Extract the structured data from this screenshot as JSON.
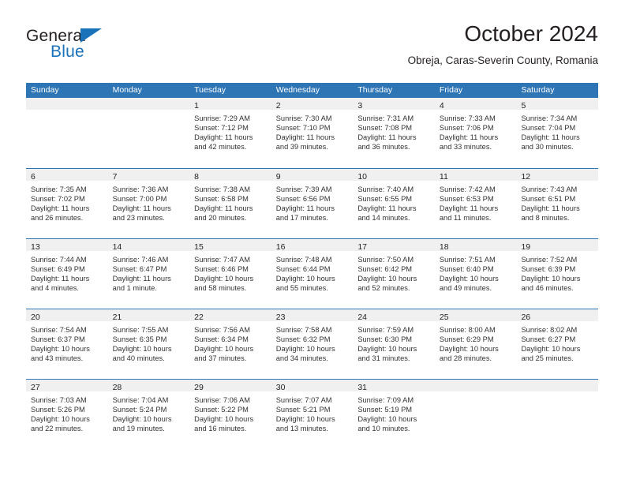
{
  "logo": {
    "word_top": "General",
    "word_bottom": "Blue",
    "accent_color": "#1a72ba"
  },
  "header": {
    "title": "October 2024",
    "subtitle": "Obreja, Caras-Severin County, Romania"
  },
  "theme": {
    "header_blue": "#2e75b6",
    "daynum_band": "#f0f0f0",
    "text": "#333333"
  },
  "calendar": {
    "weekdays": [
      "Sunday",
      "Monday",
      "Tuesday",
      "Wednesday",
      "Thursday",
      "Friday",
      "Saturday"
    ],
    "weeks": [
      [
        {
          "day": "",
          "empty": true
        },
        {
          "day": "",
          "empty": true
        },
        {
          "day": "1",
          "sunrise": "Sunrise: 7:29 AM",
          "sunset": "Sunset: 7:12 PM",
          "daylight1": "Daylight: 11 hours",
          "daylight2": "and 42 minutes."
        },
        {
          "day": "2",
          "sunrise": "Sunrise: 7:30 AM",
          "sunset": "Sunset: 7:10 PM",
          "daylight1": "Daylight: 11 hours",
          "daylight2": "and 39 minutes."
        },
        {
          "day": "3",
          "sunrise": "Sunrise: 7:31 AM",
          "sunset": "Sunset: 7:08 PM",
          "daylight1": "Daylight: 11 hours",
          "daylight2": "and 36 minutes."
        },
        {
          "day": "4",
          "sunrise": "Sunrise: 7:33 AM",
          "sunset": "Sunset: 7:06 PM",
          "daylight1": "Daylight: 11 hours",
          "daylight2": "and 33 minutes."
        },
        {
          "day": "5",
          "sunrise": "Sunrise: 7:34 AM",
          "sunset": "Sunset: 7:04 PM",
          "daylight1": "Daylight: 11 hours",
          "daylight2": "and 30 minutes."
        }
      ],
      [
        {
          "day": "6",
          "sunrise": "Sunrise: 7:35 AM",
          "sunset": "Sunset: 7:02 PM",
          "daylight1": "Daylight: 11 hours",
          "daylight2": "and 26 minutes."
        },
        {
          "day": "7",
          "sunrise": "Sunrise: 7:36 AM",
          "sunset": "Sunset: 7:00 PM",
          "daylight1": "Daylight: 11 hours",
          "daylight2": "and 23 minutes."
        },
        {
          "day": "8",
          "sunrise": "Sunrise: 7:38 AM",
          "sunset": "Sunset: 6:58 PM",
          "daylight1": "Daylight: 11 hours",
          "daylight2": "and 20 minutes."
        },
        {
          "day": "9",
          "sunrise": "Sunrise: 7:39 AM",
          "sunset": "Sunset: 6:56 PM",
          "daylight1": "Daylight: 11 hours",
          "daylight2": "and 17 minutes."
        },
        {
          "day": "10",
          "sunrise": "Sunrise: 7:40 AM",
          "sunset": "Sunset: 6:55 PM",
          "daylight1": "Daylight: 11 hours",
          "daylight2": "and 14 minutes."
        },
        {
          "day": "11",
          "sunrise": "Sunrise: 7:42 AM",
          "sunset": "Sunset: 6:53 PM",
          "daylight1": "Daylight: 11 hours",
          "daylight2": "and 11 minutes."
        },
        {
          "day": "12",
          "sunrise": "Sunrise: 7:43 AM",
          "sunset": "Sunset: 6:51 PM",
          "daylight1": "Daylight: 11 hours",
          "daylight2": "and 8 minutes."
        }
      ],
      [
        {
          "day": "13",
          "sunrise": "Sunrise: 7:44 AM",
          "sunset": "Sunset: 6:49 PM",
          "daylight1": "Daylight: 11 hours",
          "daylight2": "and 4 minutes."
        },
        {
          "day": "14",
          "sunrise": "Sunrise: 7:46 AM",
          "sunset": "Sunset: 6:47 PM",
          "daylight1": "Daylight: 11 hours",
          "daylight2": "and 1 minute."
        },
        {
          "day": "15",
          "sunrise": "Sunrise: 7:47 AM",
          "sunset": "Sunset: 6:46 PM",
          "daylight1": "Daylight: 10 hours",
          "daylight2": "and 58 minutes."
        },
        {
          "day": "16",
          "sunrise": "Sunrise: 7:48 AM",
          "sunset": "Sunset: 6:44 PM",
          "daylight1": "Daylight: 10 hours",
          "daylight2": "and 55 minutes."
        },
        {
          "day": "17",
          "sunrise": "Sunrise: 7:50 AM",
          "sunset": "Sunset: 6:42 PM",
          "daylight1": "Daylight: 10 hours",
          "daylight2": "and 52 minutes."
        },
        {
          "day": "18",
          "sunrise": "Sunrise: 7:51 AM",
          "sunset": "Sunset: 6:40 PM",
          "daylight1": "Daylight: 10 hours",
          "daylight2": "and 49 minutes."
        },
        {
          "day": "19",
          "sunrise": "Sunrise: 7:52 AM",
          "sunset": "Sunset: 6:39 PM",
          "daylight1": "Daylight: 10 hours",
          "daylight2": "and 46 minutes."
        }
      ],
      [
        {
          "day": "20",
          "sunrise": "Sunrise: 7:54 AM",
          "sunset": "Sunset: 6:37 PM",
          "daylight1": "Daylight: 10 hours",
          "daylight2": "and 43 minutes."
        },
        {
          "day": "21",
          "sunrise": "Sunrise: 7:55 AM",
          "sunset": "Sunset: 6:35 PM",
          "daylight1": "Daylight: 10 hours",
          "daylight2": "and 40 minutes."
        },
        {
          "day": "22",
          "sunrise": "Sunrise: 7:56 AM",
          "sunset": "Sunset: 6:34 PM",
          "daylight1": "Daylight: 10 hours",
          "daylight2": "and 37 minutes."
        },
        {
          "day": "23",
          "sunrise": "Sunrise: 7:58 AM",
          "sunset": "Sunset: 6:32 PM",
          "daylight1": "Daylight: 10 hours",
          "daylight2": "and 34 minutes."
        },
        {
          "day": "24",
          "sunrise": "Sunrise: 7:59 AM",
          "sunset": "Sunset: 6:30 PM",
          "daylight1": "Daylight: 10 hours",
          "daylight2": "and 31 minutes."
        },
        {
          "day": "25",
          "sunrise": "Sunrise: 8:00 AM",
          "sunset": "Sunset: 6:29 PM",
          "daylight1": "Daylight: 10 hours",
          "daylight2": "and 28 minutes."
        },
        {
          "day": "26",
          "sunrise": "Sunrise: 8:02 AM",
          "sunset": "Sunset: 6:27 PM",
          "daylight1": "Daylight: 10 hours",
          "daylight2": "and 25 minutes."
        }
      ],
      [
        {
          "day": "27",
          "sunrise": "Sunrise: 7:03 AM",
          "sunset": "Sunset: 5:26 PM",
          "daylight1": "Daylight: 10 hours",
          "daylight2": "and 22 minutes."
        },
        {
          "day": "28",
          "sunrise": "Sunrise: 7:04 AM",
          "sunset": "Sunset: 5:24 PM",
          "daylight1": "Daylight: 10 hours",
          "daylight2": "and 19 minutes."
        },
        {
          "day": "29",
          "sunrise": "Sunrise: 7:06 AM",
          "sunset": "Sunset: 5:22 PM",
          "daylight1": "Daylight: 10 hours",
          "daylight2": "and 16 minutes."
        },
        {
          "day": "30",
          "sunrise": "Sunrise: 7:07 AM",
          "sunset": "Sunset: 5:21 PM",
          "daylight1": "Daylight: 10 hours",
          "daylight2": "and 13 minutes."
        },
        {
          "day": "31",
          "sunrise": "Sunrise: 7:09 AM",
          "sunset": "Sunset: 5:19 PM",
          "daylight1": "Daylight: 10 hours",
          "daylight2": "and 10 minutes."
        },
        {
          "day": "",
          "empty": true
        },
        {
          "day": "",
          "empty": true
        }
      ]
    ]
  }
}
